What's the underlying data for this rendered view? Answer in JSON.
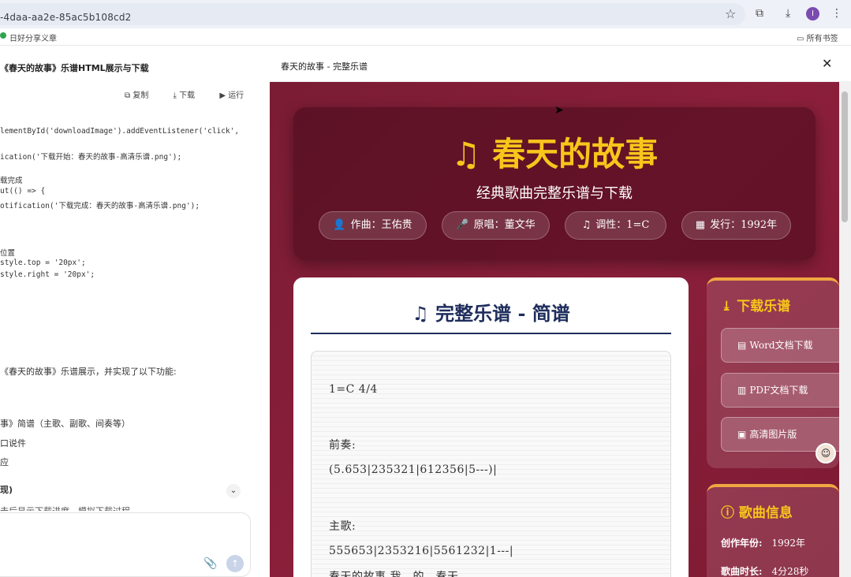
{
  "browser": {
    "url": "-4daa-aa2e-85ac5b108cd2",
    "bookmark": "日好分享义章",
    "bookmark_right": "所有书签",
    "profile_initial": "I"
  },
  "chat": {
    "title": "《春天的故事》乐谱HTML展示与下载",
    "actions": {
      "copy": "复制",
      "download": "下载",
      "run": "运行"
    },
    "code_lines": [
      "lementById('downloadImage').addEventListener('click',",
      "ication('下载开始：春天的故事-高清乐谱.png');",
      "载完成",
      "ut(() => {",
      "otification('下载完成：春天的故事-高清乐谱.png');",
      "位置",
      "style.top = '20px';",
      "style.right = '20px';"
    ],
    "text_lines": [
      "《春天的故事》乐谱展示，并实现了以下功能:",
      "事》简谱（主歌、副歌、间奏等）",
      "口说件",
      "应"
    ],
    "bold_line": "现)",
    "last_line": "击后显示下载进度，模拟下载过程"
  },
  "preview": {
    "title": "春天的故事 - 完整乐谱",
    "hero": {
      "title": "春天的故事",
      "subtitle": "经典歌曲完整乐谱与下载",
      "chips": [
        {
          "icon": "user-icon",
          "glyph": "👤",
          "label": "作曲：王佑贵"
        },
        {
          "icon": "microphone-icon",
          "glyph": "🎤",
          "label": "原唱：董文华"
        },
        {
          "icon": "music-note-icon",
          "glyph": "♫",
          "label": "调性：1=C"
        },
        {
          "icon": "calendar-icon",
          "glyph": "▦",
          "label": "发行：1992年"
        }
      ]
    },
    "score": {
      "heading": "完整乐谱 - 简谱",
      "lines": [
        "1=C 4/4",
        "前奏:",
        "(5.653|235321|612356|5---)|",
        "主歌:",
        "555653|2353216|5561232|1---|",
        "春天的故事  我　的　春天"
      ]
    },
    "download": {
      "heading": "下载乐谱",
      "buttons": [
        "Word文档下载",
        "PDF文档下载",
        "高清图片版"
      ]
    },
    "info": {
      "heading": "歌曲信息",
      "rows": [
        {
          "key": "创作年份:",
          "value": "1992年"
        },
        {
          "key": "歌曲时长:",
          "value": "4分28秒"
        }
      ]
    }
  },
  "colors": {
    "accent_gold": "#f8c51b",
    "bg_maroon": "#8b1f3b",
    "score_navy": "#1f2d5c"
  }
}
